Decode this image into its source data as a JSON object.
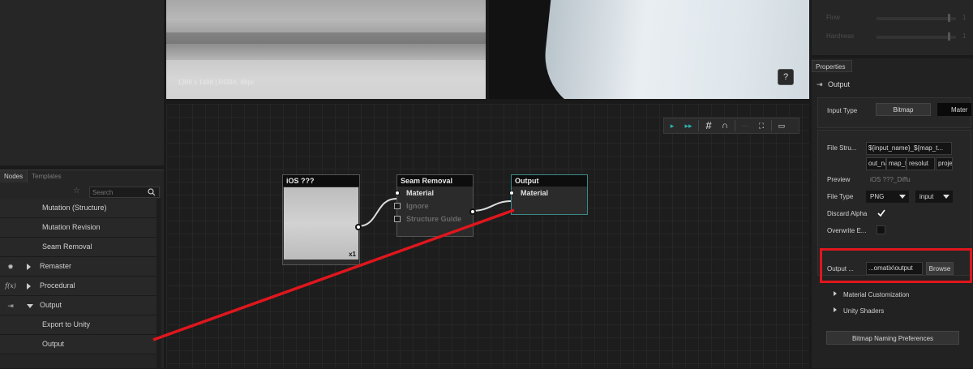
{
  "left_panel": {
    "tabs": [
      "Nodes",
      "Templates"
    ],
    "search_placeholder": "Search",
    "items": [
      {
        "label": "Mutation (Structure)",
        "type": "child"
      },
      {
        "label": "Mutation Revision",
        "type": "child"
      },
      {
        "label": "Seam Removal",
        "type": "child"
      },
      {
        "label": "Remaster",
        "type": "group",
        "icon": "gear-icon",
        "expanded": false
      },
      {
        "label": "Procedural",
        "type": "group",
        "icon": "function-icon",
        "icon_text": "f(x)",
        "expanded": false
      },
      {
        "label": "Output",
        "type": "group",
        "icon": "output-icon",
        "expanded": true
      },
      {
        "label": "Export to Unity",
        "type": "child"
      },
      {
        "label": "Output",
        "type": "child"
      }
    ]
  },
  "viewport": {
    "texture_info": "1389 x 1488 | RGBA, 8bpc",
    "help_label": "?"
  },
  "graph": {
    "toolbar": [
      "play-icon",
      "fast-forward-icon",
      "grid-icon",
      "magnet-icon",
      "fit-icon",
      "frame-icon",
      "window-icon"
    ],
    "nodes": {
      "input": {
        "title": "iOS ???",
        "multiplier": "x1"
      },
      "seam": {
        "title": "Seam Removal",
        "ports": [
          "Material",
          "Ignore",
          "Structure Guide"
        ]
      },
      "output": {
        "title": "Output",
        "ports": [
          "Material"
        ]
      }
    }
  },
  "right_top": {
    "sliders": [
      {
        "label": "Flow",
        "value": "1"
      },
      {
        "label": "Hardness",
        "value": "1"
      }
    ]
  },
  "properties": {
    "tab": "Properties",
    "section": "Output",
    "input_type_label": "Input Type",
    "input_type_options": [
      "Bitmap",
      "Mater"
    ],
    "file_structure_label": "File Stru...",
    "file_structure_value": "${input_name}_${map_t...",
    "file_structure_parts": [
      "out_name",
      "map_type",
      "resolut",
      "proje"
    ],
    "preview_label": "Preview",
    "preview_value": "iOS ???_Diffu",
    "file_type_label": "File Type",
    "file_type_value": "PNG",
    "file_type_bits": "input",
    "discard_alpha_label": "Discard Alpha",
    "overwrite_label": "Overwrite E...",
    "output_label": "Output ...",
    "output_value": "...omatix\\output",
    "browse_label": "Browse",
    "tree": [
      "Material Customization",
      "Unity Shaders"
    ],
    "naming_button": "Bitmap Naming Preferences"
  },
  "colors": {
    "accent_teal": "#2fb5b5",
    "annotation_red": "#e0161d"
  }
}
